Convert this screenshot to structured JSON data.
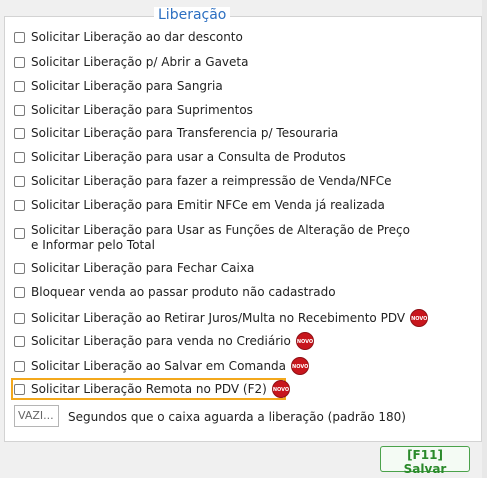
{
  "group": {
    "title": "Liberação",
    "options": [
      {
        "label": "Solicitar Liberação ao dar desconto",
        "checked": false,
        "novo": false
      },
      {
        "label": "Solicitar Liberação p/ Abrir a Gaveta",
        "checked": false,
        "novo": false
      },
      {
        "label": "Solicitar Liberação para Sangria",
        "checked": false,
        "novo": false
      },
      {
        "label": "Solicitar Liberação para Suprimentos",
        "checked": false,
        "novo": false
      },
      {
        "label": "Solicitar Liberação para Transferencia p/ Tesouraria",
        "checked": false,
        "novo": false
      },
      {
        "label": "Solicitar Liberação para usar a Consulta de Produtos",
        "checked": false,
        "novo": false
      },
      {
        "label": "Solicitar Liberação para fazer a reimpressão de Venda/NFCe",
        "checked": false,
        "novo": false
      },
      {
        "label": "Solicitar Liberação para Emitir NFCe em Venda já realizada",
        "checked": false,
        "novo": false
      },
      {
        "label_line1": "Solicitar Liberação para Usar as Funções de Alteração de Preço",
        "label_line2": "e Informar pelo Total",
        "checked": false,
        "novo": false
      },
      {
        "label": "Solicitar Liberação para Fechar Caixa",
        "checked": false,
        "novo": false
      },
      {
        "label": "Bloquear venda ao passar produto não cadastrado",
        "checked": false,
        "novo": false
      },
      {
        "label": "Solicitar Liberação ao Retirar Juros/Multa no Recebimento PDV",
        "checked": false,
        "novo": true
      },
      {
        "label": "Solicitar Liberação para venda no Crediário",
        "checked": false,
        "novo": true
      },
      {
        "label": "Solicitar Liberação ao Salvar em Comanda",
        "checked": false,
        "novo": true
      },
      {
        "label": "Solicitar Liberação Remota no PDV (F2)",
        "checked": false,
        "novo": true,
        "highlighted": true
      }
    ],
    "badge_text": "NOVO",
    "timeout": {
      "value_text": "VAZI...",
      "label": "Segundos que o caixa aguarda a liberação (padrão 180)"
    }
  },
  "footer": {
    "save_label": "[F11] Salvar"
  },
  "colors": {
    "title": "#2c6fc1",
    "badge": "#c8161d",
    "highlight": "#f3a81c",
    "save": "#2a8a2a"
  }
}
